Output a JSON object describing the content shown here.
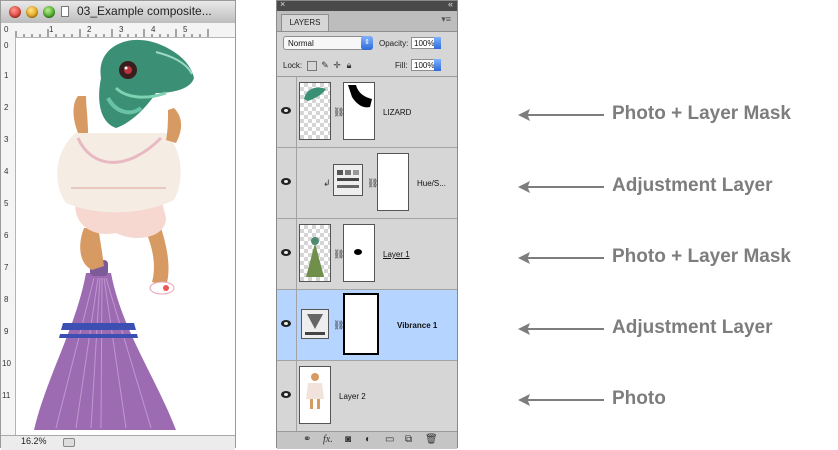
{
  "document": {
    "title": "03_Example composite...",
    "zoom": "16.2%",
    "ruler_top_ticks": [
      "0",
      "1",
      "2",
      "3",
      "4",
      "5"
    ],
    "ruler_left_ticks": [
      "0",
      "1",
      "2",
      "3",
      "4",
      "5",
      "6",
      "7",
      "8",
      "9",
      "10",
      "11"
    ]
  },
  "layers_panel": {
    "tab_label": "LAYERS",
    "blend_mode": "Normal",
    "opacity_label": "Opacity:",
    "opacity_value": "100%",
    "lock_label": "Lock:",
    "fill_label": "Fill:",
    "fill_value": "100%",
    "layers": [
      {
        "name": "LIZARD",
        "selected": false
      },
      {
        "name": "Hue/S...",
        "selected": false
      },
      {
        "name": "Layer 1",
        "selected": false
      },
      {
        "name": "Vibrance 1",
        "selected": true
      },
      {
        "name": "Layer 2",
        "selected": false
      }
    ]
  },
  "annotations": [
    "Photo + Layer Mask",
    "Adjustment Layer",
    "Photo + Layer Mask",
    "Adjustment Layer",
    "Photo"
  ],
  "colors": {
    "selected_row": "#b5d4ff",
    "annotation_text": "#7d7d7d",
    "panel_bg": "#d6d6d6"
  }
}
